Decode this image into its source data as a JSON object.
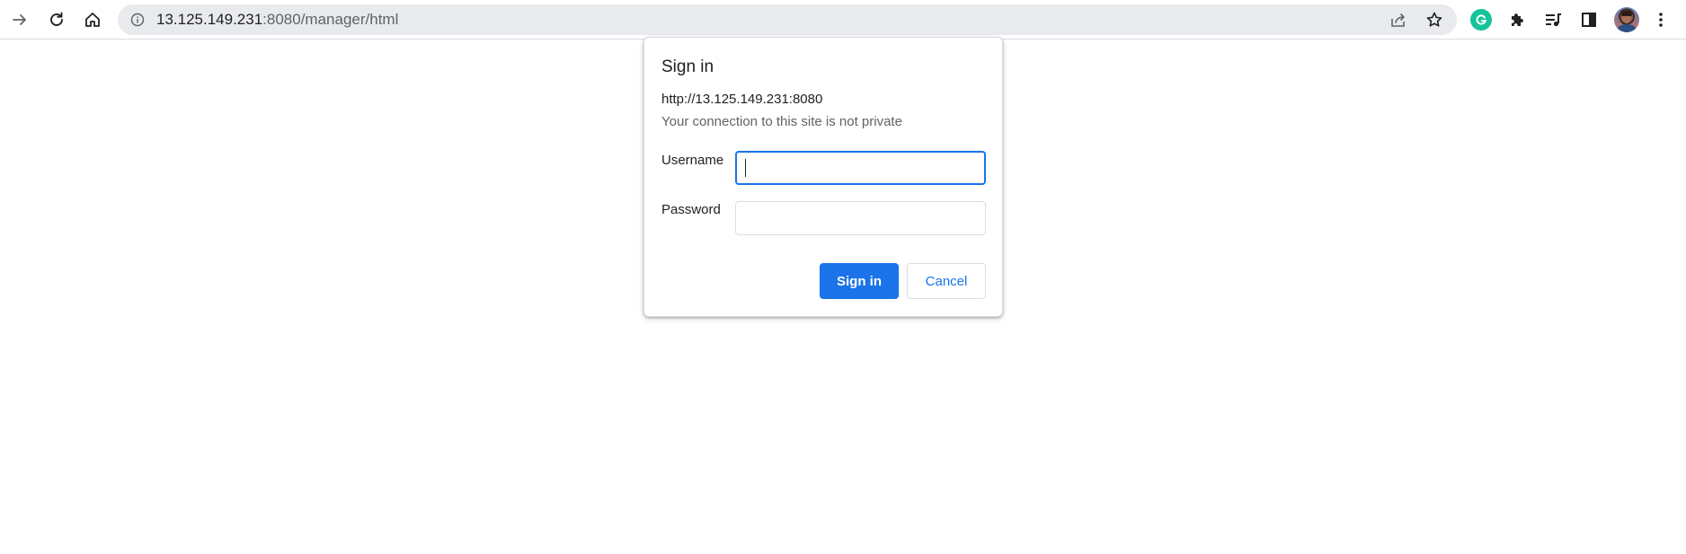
{
  "browser": {
    "url_host": "13.125.149.231",
    "url_path": ":8080/manager/html",
    "icons": {
      "forward": "arrow-right-icon",
      "reload": "reload-icon",
      "home": "home-icon",
      "site_info": "info-icon",
      "share": "share-icon",
      "bookmark": "star-icon",
      "grammarly": "grammarly-icon",
      "extensions": "puzzle-icon",
      "media": "playlist-icon",
      "side_panel": "side-panel-icon",
      "profile": "avatar",
      "menu": "kebab-menu-icon"
    }
  },
  "dialog": {
    "title": "Sign in",
    "origin": "http://13.125.149.231:8080",
    "warning": "Your connection to this site is not private",
    "username_label": "Username",
    "username_value": "",
    "password_label": "Password",
    "password_value": "",
    "sign_in_label": "Sign in",
    "cancel_label": "Cancel"
  },
  "colors": {
    "accent": "#1a73e8",
    "grammarly": "#15c39a",
    "omnibox_bg": "#e8eaed"
  }
}
